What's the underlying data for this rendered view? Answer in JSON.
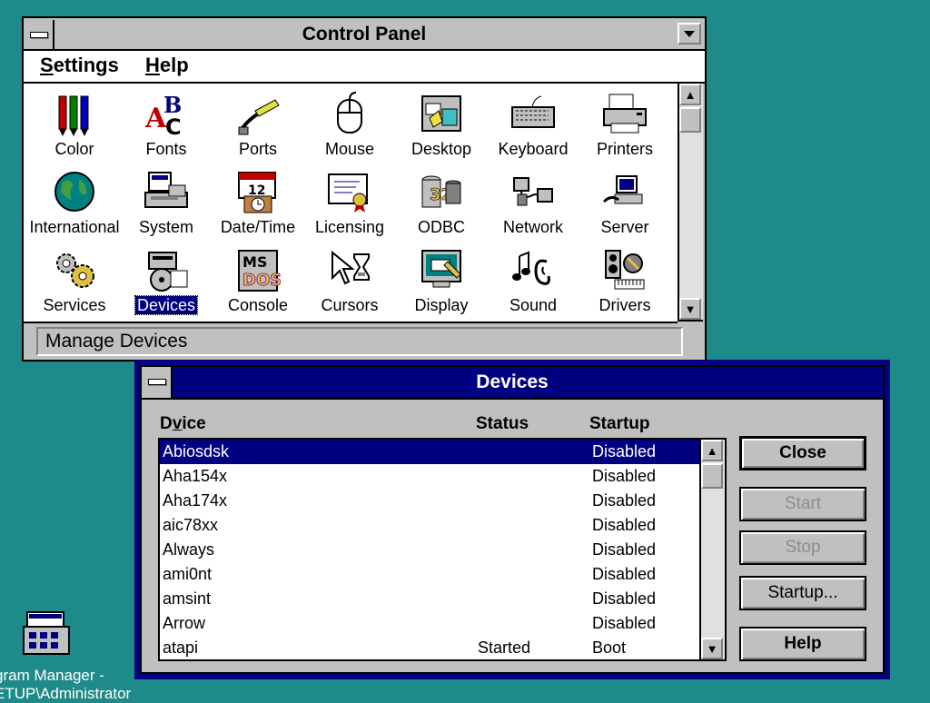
{
  "control_panel": {
    "title": "Control Panel",
    "menu": [
      {
        "label": "Settings",
        "accel": "S",
        "rest": "ettings"
      },
      {
        "label": "Help",
        "accel": "H",
        "rest": "elp"
      }
    ],
    "icons": [
      {
        "label": "Color",
        "icon": "color-icon"
      },
      {
        "label": "Fonts",
        "icon": "fonts-icon"
      },
      {
        "label": "Ports",
        "icon": "ports-icon"
      },
      {
        "label": "Mouse",
        "icon": "mouse-icon"
      },
      {
        "label": "Desktop",
        "icon": "desktop-icon"
      },
      {
        "label": "Keyboard",
        "icon": "keyboard-icon"
      },
      {
        "label": "Printers",
        "icon": "printers-icon"
      },
      {
        "label": "International",
        "icon": "globe-icon"
      },
      {
        "label": "System",
        "icon": "system-icon"
      },
      {
        "label": "Date/Time",
        "icon": "calendar-clock-icon"
      },
      {
        "label": "Licensing",
        "icon": "certificate-icon"
      },
      {
        "label": "ODBC",
        "icon": "odbc-icon"
      },
      {
        "label": "Network",
        "icon": "network-icon"
      },
      {
        "label": "Server",
        "icon": "server-icon"
      },
      {
        "label": "Services",
        "icon": "gears-icon"
      },
      {
        "label": "Devices",
        "icon": "devices-icon",
        "selected": true
      },
      {
        "label": "Console",
        "icon": "msdos-icon"
      },
      {
        "label": "Cursors",
        "icon": "cursors-icon"
      },
      {
        "label": "Display",
        "icon": "display-icon"
      },
      {
        "label": "Sound",
        "icon": "sound-icon"
      },
      {
        "label": "Drivers",
        "icon": "drivers-icon"
      }
    ],
    "status_text": "Manage Devices"
  },
  "devices_dialog": {
    "title": "Devices",
    "columns": {
      "device": "Device",
      "device_accel": "v",
      "status": "Status",
      "startup": "Startup"
    },
    "rows": [
      {
        "device": "Abiosdsk",
        "status": "",
        "startup": "Disabled"
      },
      {
        "device": "Aha154x",
        "status": "",
        "startup": "Disabled"
      },
      {
        "device": "Aha174x",
        "status": "",
        "startup": "Disabled"
      },
      {
        "device": "aic78xx",
        "status": "",
        "startup": "Disabled"
      },
      {
        "device": "Always",
        "status": "",
        "startup": "Disabled"
      },
      {
        "device": "ami0nt",
        "status": "",
        "startup": "Disabled"
      },
      {
        "device": "amsint",
        "status": "",
        "startup": "Disabled"
      },
      {
        "device": "Arrow",
        "status": "",
        "startup": "Disabled"
      },
      {
        "device": "atapi",
        "status": "Started",
        "startup": "Boot"
      }
    ],
    "selected_row": 0,
    "buttons": {
      "close": "Close",
      "start": "Start",
      "stop": "Stop",
      "startup": "Startup...",
      "help": "Help"
    }
  },
  "desktop": {
    "program_manager_label_line1": "gram Manager -",
    "program_manager_label_line2": "ETUP\\Administrator"
  },
  "colors": {
    "desktop": "#1f8a8a",
    "selection": "#000080",
    "window_face": "#c0c0c0"
  }
}
